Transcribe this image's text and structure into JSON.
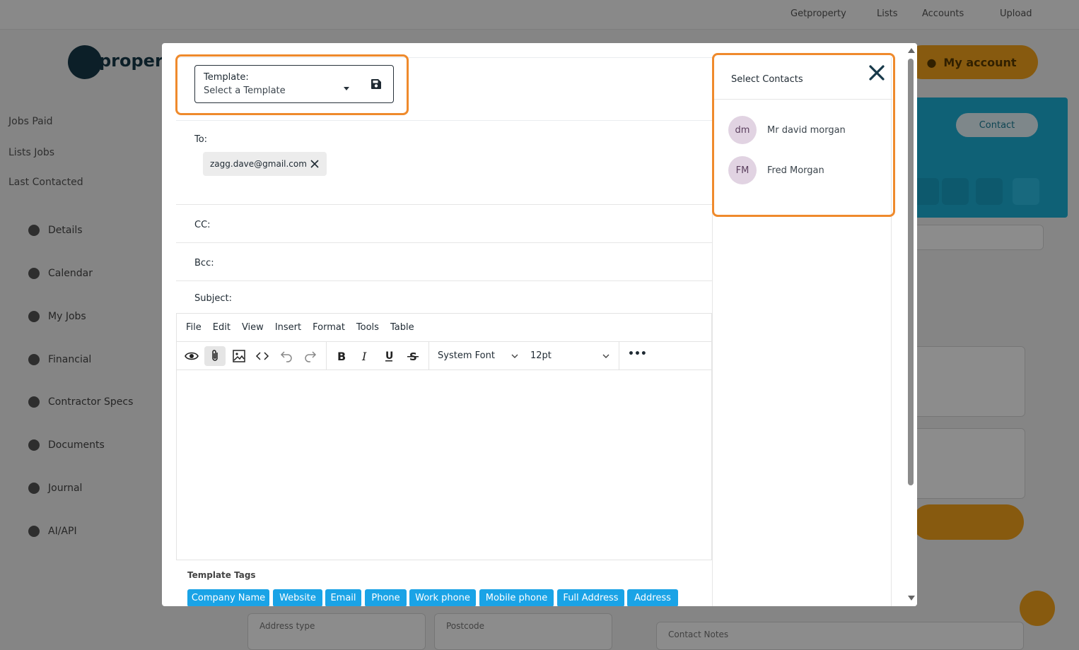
{
  "background": {
    "top_nav": [
      "Getproperty",
      "Lists",
      "Accounts",
      "Upload"
    ],
    "logo_text": "property",
    "side_meta": [
      "Jobs Paid",
      "Lists Jobs",
      "Last Contacted"
    ],
    "side_items": [
      "Details",
      "Calendar",
      "My Jobs",
      "Financial",
      "Contractor Specs",
      "Documents",
      "Journal",
      "AI/API"
    ],
    "account_label": "My account",
    "pill_label": "Contact",
    "bottom_fields": [
      "Address type",
      "Postcode",
      "Contact Notes"
    ]
  },
  "modal": {
    "template": {
      "label": "Template:",
      "value": "Select a Template",
      "save_icon": "save-icon"
    },
    "to_label": "To:",
    "to_chip": "zagg.dave@gmail.com",
    "cc_label": "CC:",
    "bcc_label": "Bcc:",
    "subject_label": "Subject:",
    "editor": {
      "menu": [
        "File",
        "Edit",
        "View",
        "Insert",
        "Format",
        "Tools",
        "Table"
      ],
      "font_family": "System Font",
      "font_size": "12pt",
      "more": "•••"
    },
    "template_tags_title": "Template Tags",
    "template_tags": [
      "Company Name",
      "Website",
      "Email",
      "Phone",
      "Work phone",
      "Mobile phone",
      "Full Address",
      "Address"
    ],
    "contacts": {
      "title": "Select Contacts",
      "list": [
        {
          "initials": "dm",
          "name": "Mr david morgan"
        },
        {
          "initials": "FM",
          "name": "Fred Morgan"
        }
      ]
    }
  },
  "colors": {
    "highlight": "#ef8a2c",
    "tag": "#1aa3e6",
    "avatar": "#e1d3e2"
  }
}
